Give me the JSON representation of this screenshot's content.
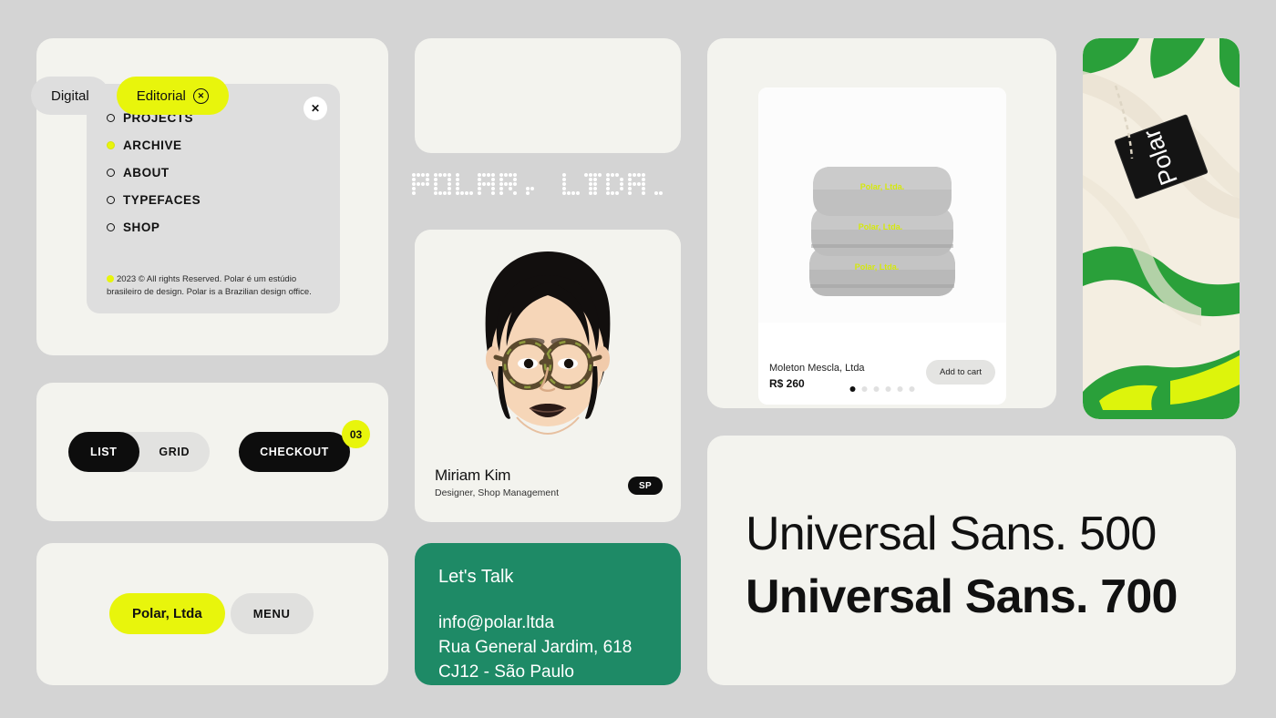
{
  "theme": {
    "page_bg": "#d4d4d4",
    "card_bg": "#f3f3ee",
    "accent_yellow": "#e8f50c",
    "accent_green": "#1e8a66",
    "black": "#0d0d0d"
  },
  "nav": {
    "close_label": "✕",
    "items": [
      {
        "label": "PROJECTS",
        "active": false
      },
      {
        "label": "ARCHIVE",
        "active": true
      },
      {
        "label": "ABOUT",
        "active": false
      },
      {
        "label": "TYPEFACES",
        "active": false
      },
      {
        "label": "SHOP",
        "active": false
      }
    ],
    "footer": "2023 © All rights Reserved. Polar é um estúdio brasileiro de design. Polar is a Brazilian design office."
  },
  "view_toggle": {
    "options": [
      {
        "label": "LIST",
        "selected": true
      },
      {
        "label": "GRID",
        "selected": false
      }
    ]
  },
  "checkout": {
    "label": "CHECKOUT",
    "badge_count": "03"
  },
  "brand_pills": {
    "primary": "Polar, Ltda",
    "secondary": "MENU"
  },
  "filter_chips": {
    "items": [
      {
        "label": "Digital",
        "selected": false,
        "removable": false
      },
      {
        "label": "Editorial",
        "selected": true,
        "removable": true
      }
    ],
    "remove_icon": "✕"
  },
  "wordmark": {
    "text": "POLAR, LTDA.",
    "style": "dot-matrix"
  },
  "person": {
    "name": "Miriam Kim",
    "role": "Designer, Shop Management",
    "badge": "SP"
  },
  "contact": {
    "title": "Let's Talk",
    "lines": [
      "info@polar.ltda",
      "Rua General Jardim, 618",
      "CJ12 - São Paulo"
    ]
  },
  "product": {
    "name": "Moleton Mescla, Ltda",
    "price": "R$ 260",
    "add_to_cart": "Add to cart",
    "embroidery_text": "Polar, Ltda.",
    "carousel": {
      "total": 6,
      "active_index": 0
    }
  },
  "typography": {
    "lines": [
      {
        "text": "Universal Sans. 500",
        "weight": "500"
      },
      {
        "text": "Universal Sans. 700",
        "weight": "700"
      }
    ]
  },
  "fabric_photo": {
    "label_text": "Polar"
  }
}
